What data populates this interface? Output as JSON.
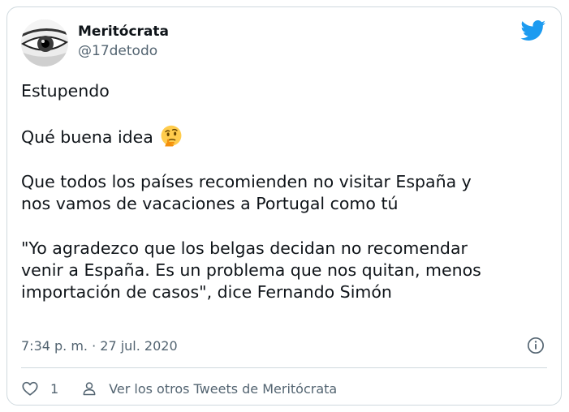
{
  "author": {
    "name": "Meritócrata",
    "handle": "@17detodo",
    "avatar_icon": "eye-avatar-icon"
  },
  "tweet": {
    "paragraphs": [
      "Estupendo",
      "Qué buena idea",
      "Que todos los países recomienden no visitar España y\nnos vamos de vacaciones a Portugal como tú",
      "\"Yo agradezco que los belgas decidan no recomendar\nvenir a España. Es un problema que nos quitan, menos\nimportación de casos\", dice Fernando Simón"
    ],
    "emoji": "thinking-face-icon",
    "timestamp": "7:34 p. m. · 27 jul. 2020"
  },
  "footer": {
    "like_count": "1",
    "others_label": "Ver los otros Tweets de Meritócrata"
  },
  "colors": {
    "twitter_blue": "#1d9bf0",
    "text": "#0f1419",
    "muted": "#536471",
    "border": "#cfd9de"
  }
}
